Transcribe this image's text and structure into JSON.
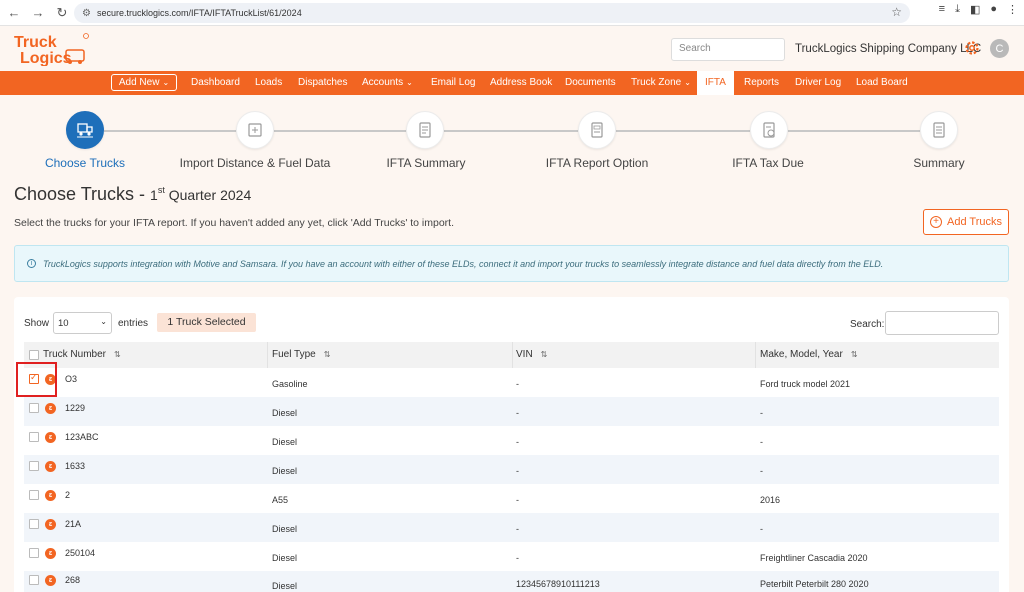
{
  "browser": {
    "url": "secure.trucklogics.com/IFTA/IFTATruckList/61/2024"
  },
  "header": {
    "logo_line1": "Truck",
    "logo_line2": "Logics",
    "search_placeholder": "Search",
    "company": "TruckLogics Shipping Company LLC",
    "avatar_letter": "C"
  },
  "nav": {
    "add_new": "Add New",
    "items": [
      "Dashboard",
      "Loads",
      "Dispatches",
      "Accounts",
      "Email Log",
      "Address Book",
      "Documents",
      "Truck Zone",
      "IFTA",
      "Reports",
      "Driver Log",
      "Load Board"
    ],
    "active": "IFTA",
    "accent": "#f26522"
  },
  "stepper": {
    "steps": [
      "Choose Trucks",
      "Import Distance & Fuel Data",
      "IFTA Summary",
      "IFTA Report Option",
      "IFTA Tax Due",
      "Summary"
    ],
    "active_index": 0
  },
  "page": {
    "title": "Choose Trucks - ",
    "quarter_num": "1",
    "quarter_sup": "st",
    "quarter_rest": " Quarter 2024",
    "subtitle": "Select the trucks for your IFTA report. If you haven't added any yet, click 'Add Trucks' to import.",
    "add_trucks": "Add Trucks",
    "info": "TruckLogics supports integration with Motive and Samsara. If you have an account with either of these ELDs, connect it and import your trucks to seamlessly integrate distance and fuel data directly from the ELD."
  },
  "table": {
    "show_label": "Show",
    "entries_value": "10",
    "entries_label": "entries",
    "selected_badge": "1 Truck Selected",
    "search_label": "Search:",
    "columns": [
      "Truck Number",
      "Fuel Type",
      "VIN",
      "Make, Model, Year"
    ],
    "rows": [
      {
        "truck": "O3",
        "fuel": "Gasoline",
        "vin": "-",
        "make": "Ford truck model 2021",
        "checked": true
      },
      {
        "truck": "1229",
        "fuel": "Diesel",
        "vin": "-",
        "make": "-",
        "checked": false
      },
      {
        "truck": "123ABC",
        "fuel": "Diesel",
        "vin": "-",
        "make": "-",
        "checked": false
      },
      {
        "truck": "1633",
        "fuel": "Diesel",
        "vin": "-",
        "make": "-",
        "checked": false
      },
      {
        "truck": "2",
        "fuel": "A55",
        "vin": "-",
        "make": "2016",
        "checked": false
      },
      {
        "truck": "21A",
        "fuel": "Diesel",
        "vin": "-",
        "make": "-",
        "checked": false
      },
      {
        "truck": "250104",
        "fuel": "Diesel",
        "vin": "-",
        "make": "Freightliner Cascadia 2020",
        "checked": false
      },
      {
        "truck": "268",
        "fuel": "Diesel",
        "vin": "12345678910111213",
        "make": "Peterbilt Peterbilt 280 2020",
        "checked": false
      }
    ]
  }
}
